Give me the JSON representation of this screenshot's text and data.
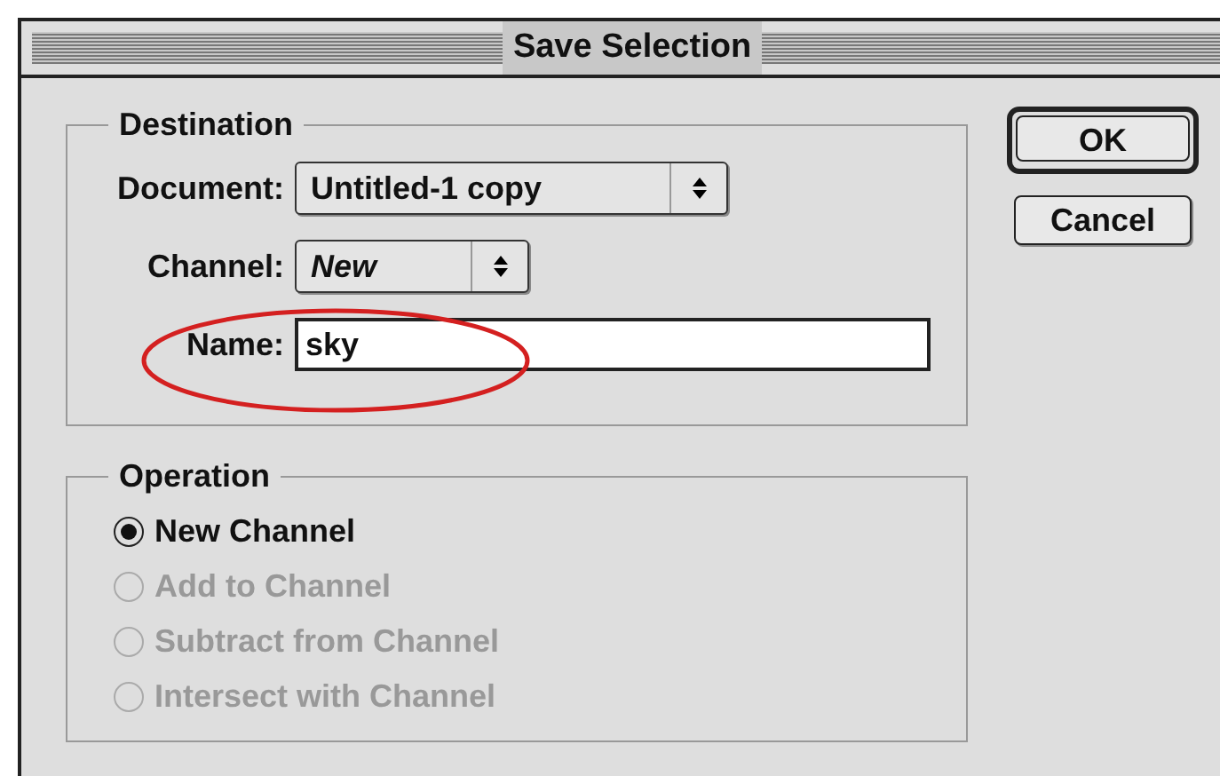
{
  "window": {
    "title": "Save Selection"
  },
  "destination": {
    "legend": "Destination",
    "document": {
      "label": "Document:",
      "value": "Untitled-1 copy"
    },
    "channel": {
      "label": "Channel:",
      "value": "New"
    },
    "name": {
      "label": "Name:",
      "value": "sky"
    }
  },
  "operation": {
    "legend": "Operation",
    "options": [
      {
        "label": "New Channel",
        "selected": true,
        "disabled": false
      },
      {
        "label": "Add to Channel",
        "selected": false,
        "disabled": true
      },
      {
        "label": "Subtract from Channel",
        "selected": false,
        "disabled": true
      },
      {
        "label": "Intersect with Channel",
        "selected": false,
        "disabled": true
      }
    ]
  },
  "buttons": [
    {
      "label": "OK",
      "default": true
    },
    {
      "label": "Cancel",
      "default": false
    }
  ]
}
